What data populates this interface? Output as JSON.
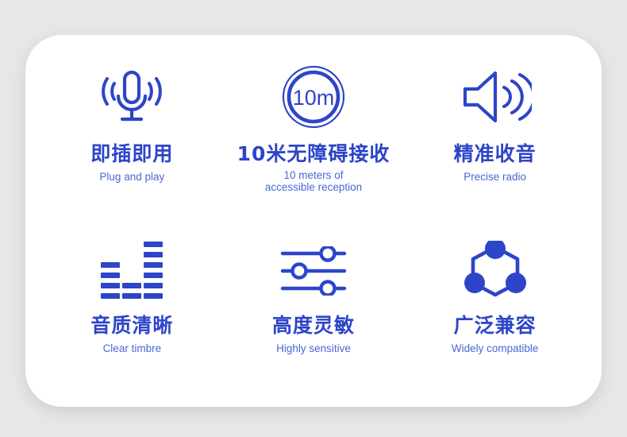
{
  "theme": {
    "page_background": "#e7e7e9",
    "card_background": "#ffffff",
    "primary_blue": "#2d45c9",
    "subtitle_blue": "#4a66d6"
  },
  "card": {
    "features": [
      {
        "icon": "microphone-icon",
        "title_cn": "即插即用",
        "subtitle_en": "Plug and play"
      },
      {
        "icon": "range-10m-icon",
        "icon_label": "10m",
        "title_cn": "10米无障碍接收",
        "subtitle_en": "10 meters of\naccessible reception"
      },
      {
        "icon": "speaker-waves-icon",
        "title_cn": "精准收音",
        "subtitle_en": "Precise radio"
      },
      {
        "icon": "equalizer-icon",
        "title_cn": "音质清晰",
        "subtitle_en": "Clear timbre"
      },
      {
        "icon": "sliders-icon",
        "title_cn": "高度灵敏",
        "subtitle_en": "Highly sensitive"
      },
      {
        "icon": "molecule-network-icon",
        "title_cn": "广泛兼容",
        "subtitle_en": "Widely compatible"
      }
    ]
  }
}
